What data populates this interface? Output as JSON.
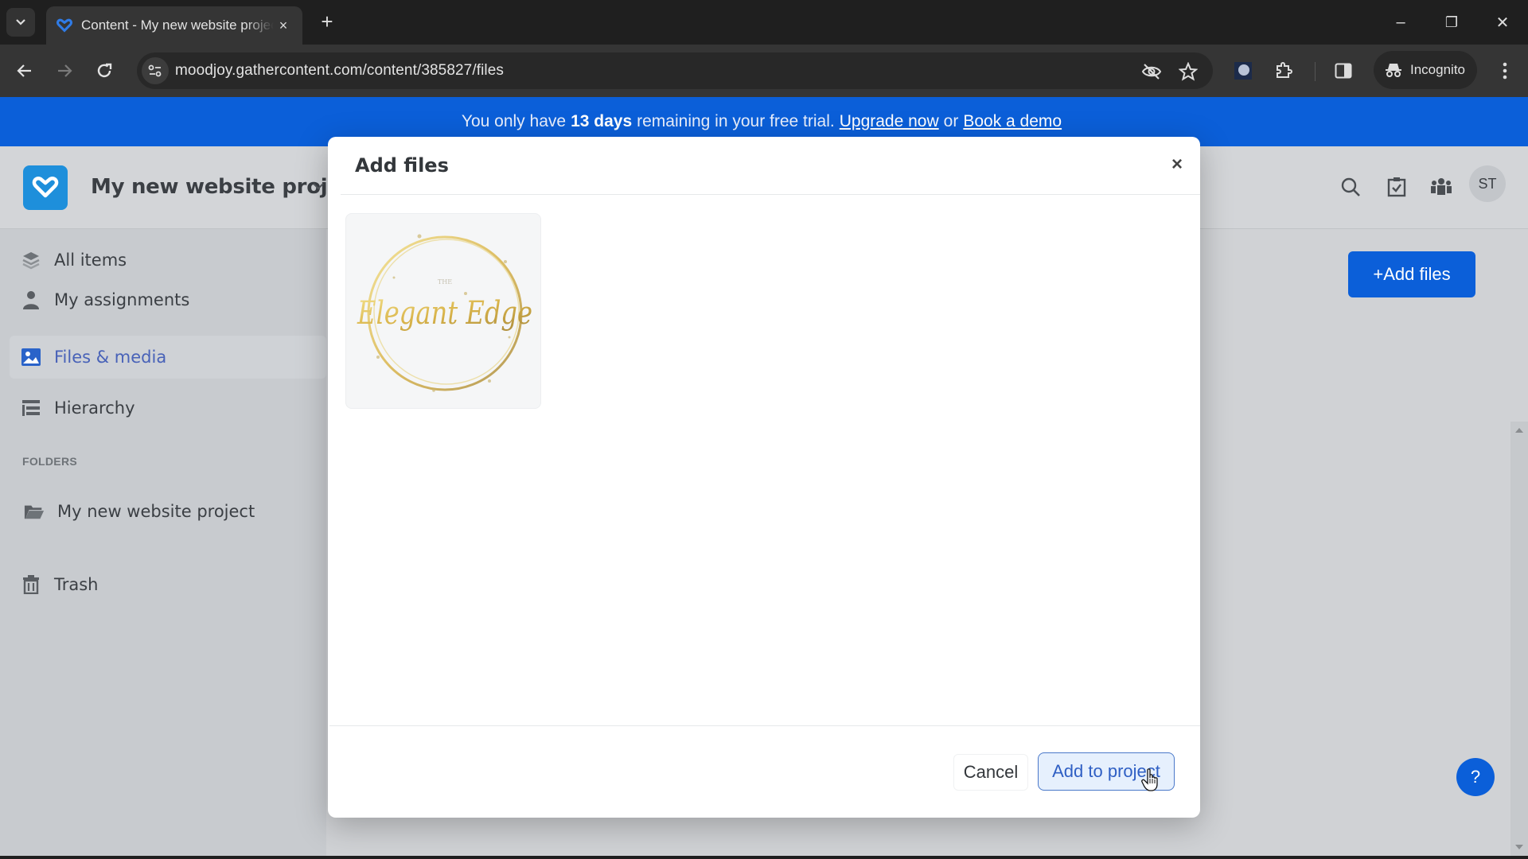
{
  "browser": {
    "tab_title": "Content - My new website project",
    "tab_close": "×",
    "new_tab": "+",
    "url": "moodjoy.gathercontent.com/content/385827/files",
    "incognito_label": "Incognito",
    "window_controls": {
      "minimize": "–",
      "restore": "❐",
      "close": "✕"
    }
  },
  "banner": {
    "prefix": "You only have",
    "days": "13 days",
    "suffix": "remaining in your free trial.",
    "upgrade_link": "Upgrade now",
    "connector": "or",
    "demo_link": "Book a demo"
  },
  "header": {
    "project_title": "My new website project",
    "avatar_initials": "ST",
    "icons": [
      "search-icon",
      "checklist-icon",
      "team-icon"
    ]
  },
  "sidebar": {
    "items": [
      {
        "label": "All items",
        "icon": "layers-icon",
        "active": false
      },
      {
        "label": "My assignments",
        "icon": "person-icon",
        "active": false
      },
      {
        "label": "Files & media",
        "icon": "image-icon",
        "active": true
      },
      {
        "label": "Hierarchy",
        "icon": "hierarchy-icon",
        "active": false
      }
    ],
    "folders_label": "FOLDERS",
    "folders": [
      {
        "label": "My new website project",
        "icon": "folder-icon"
      }
    ],
    "trash_label": "Trash"
  },
  "content": {
    "add_files_label": "+Add files",
    "help_label": "?"
  },
  "modal": {
    "title": "Add files",
    "close_label": "×",
    "files": [
      {
        "name": "The Elegant Edge logo",
        "logo_small": "THE",
        "logo_text": "Elegant Edge"
      }
    ],
    "cancel_label": "Cancel",
    "submit_label": "Add to project"
  },
  "colors": {
    "brand_blue": "#0b5fd9",
    "logo_blue": "#1e8fdb",
    "active_nav": "#4862b8"
  }
}
